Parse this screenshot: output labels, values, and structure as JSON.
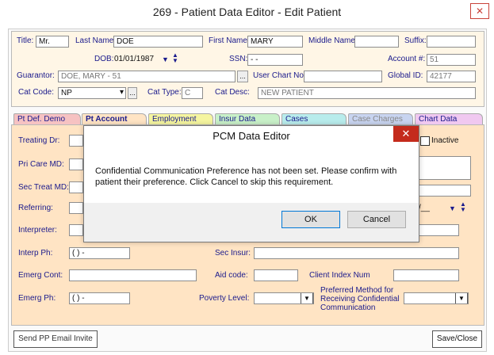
{
  "window": {
    "title": "269 - Patient Data Editor - Edit Patient",
    "close_icon": "close-x-icon"
  },
  "header": {
    "title_label": "Title:",
    "title_value": "Mr.",
    "last_name_label": "Last Name:",
    "last_name_value": "DOE",
    "first_name_label": "First Name:",
    "first_name_value": "MARY",
    "middle_name_label": "Middle Name:",
    "middle_name_value": "",
    "suffix_label": "Suffix:",
    "suffix_value": "",
    "dob_label": "DOB:",
    "dob_value": "01/01/1987",
    "ssn_label": "SSN:",
    "ssn_value": " -  - ",
    "account_label": "Account #:",
    "account_value": "51",
    "guarantor_label": "Guarantor:",
    "guarantor_value": "DOE, MARY - 51",
    "guarantor_btn": "...",
    "user_chart_label": "User Chart No:",
    "user_chart_value": "",
    "global_id_label": "Global ID:",
    "global_id_value": "42177",
    "cat_code_label": "Cat Code:",
    "cat_code_value": "NP",
    "cat_code_btn": "...",
    "cat_type_label": "Cat Type:",
    "cat_type_value": "C",
    "cat_desc_label": "Cat Desc:",
    "cat_desc_value": "NEW PATIENT"
  },
  "tabs": [
    {
      "label": "Pt Def. Demo",
      "color": "#f6c2c2"
    },
    {
      "label": "Pt Account",
      "color": "#ffe4c4"
    },
    {
      "label": "Employment",
      "color": "#f5f5a0"
    },
    {
      "label": "Insur Data",
      "color": "#c8f0c8"
    },
    {
      "label": "Cases",
      "color": "#b8ecec"
    },
    {
      "label": "Case Charges",
      "color": "#c8d4f0"
    },
    {
      "label": "Chart Data",
      "color": "#f0c8f0"
    }
  ],
  "form": {
    "treating_dr_label": "Treating Dr:",
    "inactive_label": "Inactive",
    "pri_care_label": "Pri Care MD:",
    "sec_treat_label": "Sec Treat MD:",
    "referring_label": "Referring:",
    "referring_date_value": "/__",
    "interpreter_label": "Interpreter:",
    "interp_ph_label": "Interp Ph:",
    "interp_ph_value": "(  )   -",
    "sec_insur_label": "Sec Insur:",
    "emerg_cont_label": "Emerg Cont:",
    "aid_code_label": "Aid code:",
    "client_index_label": "Client Index Num",
    "emerg_ph_label": "Emerg Ph:",
    "emerg_ph_value": "(  )   -",
    "poverty_label": "Poverty Level:",
    "preferred_label_1": "Preferred Method for",
    "preferred_label_2": "Receiving Confidential",
    "preferred_label_3": "Communication"
  },
  "footer": {
    "send_email": "Send PP Email Invite",
    "save_close": "Save/Close"
  },
  "dialog": {
    "title": "PCM Data Editor",
    "close": "✕",
    "message_1": "Confidential Communication Preference has not been set.  Please confirm with",
    "message_2": "patient their preference. Click Cancel to skip this requirement.",
    "ok": "OK",
    "cancel": "Cancel"
  }
}
